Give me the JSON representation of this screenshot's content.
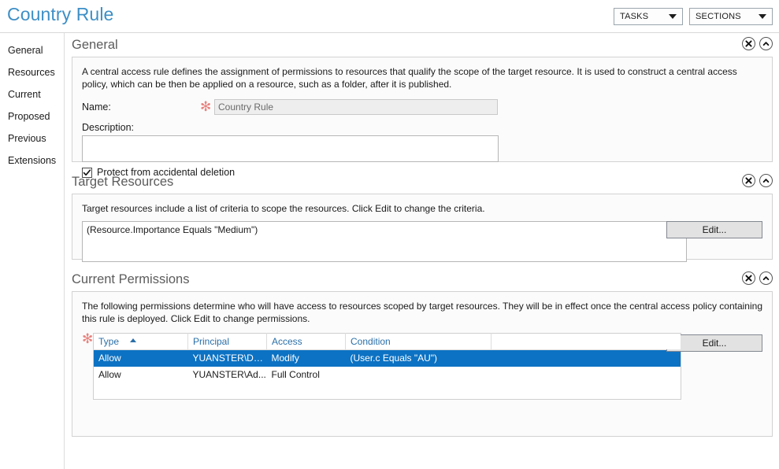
{
  "header": {
    "title": "Country Rule",
    "tasks_label": "TASKS",
    "sections_label": "SECTIONS"
  },
  "sidebar": {
    "items": [
      {
        "label": "General"
      },
      {
        "label": "Resources"
      },
      {
        "label": "Current"
      },
      {
        "label": "Proposed"
      },
      {
        "label": "Previous"
      },
      {
        "label": "Extensions"
      }
    ]
  },
  "sections": {
    "general": {
      "title": "General",
      "description": "A central access rule defines the assignment of permissions to resources that qualify the scope of the target resource. It is used to construct a central access policy, which can be then be applied on a resource, such as a folder, after it is published.",
      "name_label": "Name:",
      "name_value": "Country Rule",
      "name_required_marker": "✻",
      "description_label": "Description:",
      "description_value": "",
      "protect_checkbox_label": "Protect from accidental deletion",
      "protect_checked": true
    },
    "target_resources": {
      "title": "Target Resources",
      "description": "Target resources include a list of criteria to scope the resources. Click Edit to change the criteria.",
      "criteria_value": "(Resource.Importance Equals \"Medium\")",
      "edit_label": "Edit..."
    },
    "current_permissions": {
      "title": "Current Permissions",
      "description": "The following permissions determine who will have access to resources scoped by target resources. They will be in effect once the central access policy containing this rule is deployed. Click Edit to change permissions.",
      "edit_label": "Edit...",
      "required_marker": "✻",
      "columns": [
        "Type",
        "Principal",
        "Access",
        "Condition",
        ""
      ],
      "sorted_column": "Type",
      "sort_direction": "asc",
      "rows": [
        {
          "type": "Allow",
          "principal": "YUANSTER\\Do...",
          "access": "Modify",
          "condition": "(User.c Equals \"AU\")",
          "extra": "",
          "selected": true
        },
        {
          "type": "Allow",
          "principal": "YUANSTER\\Ad...",
          "access": "Full Control",
          "condition": "",
          "extra": "",
          "selected": false
        }
      ]
    }
  },
  "colors": {
    "title_blue": "#3d8fc6",
    "selection_blue": "#0c72c3",
    "column_header_blue": "#2a6fa8",
    "required_asterisk": "#e8827e"
  }
}
